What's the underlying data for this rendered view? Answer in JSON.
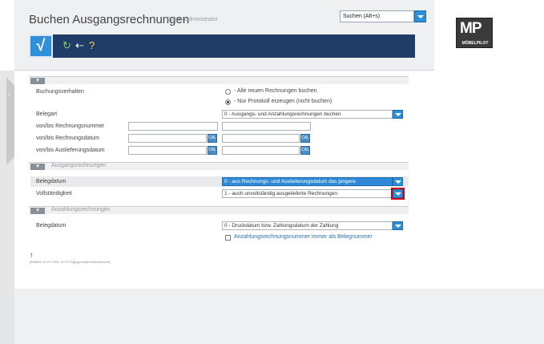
{
  "header": {
    "title": "Buchen Ausgangsrechnungen",
    "subtitle": "Systemadministrator",
    "search_value": "Suchen (Alt+s)"
  },
  "toolbar": {
    "confirm_glyph": "√",
    "refresh_glyph": "↻",
    "back_glyph": "⇠",
    "help_glyph": "?"
  },
  "logo": {
    "mark": "MP",
    "text": "MÖBELPILOT"
  },
  "sections": {
    "main": {
      "toggle": "▾"
    },
    "ausgang": {
      "toggle": "▾",
      "title": "Ausgangsrechnungen"
    },
    "anzahlung": {
      "toggle": "▾",
      "title": "Anzahlungsrechnungen"
    }
  },
  "form": {
    "buchungsverhalten": {
      "label": "Buchungsverhalten",
      "options": [
        "- Alle neuen Rechnungen buchen",
        "- Nur Protokoll erzeugen (nicht buchen)"
      ],
      "selected_index": 1
    },
    "belegart": {
      "label": "Belegart",
      "value": "0 - Ausgangs- und Anzahlungsrechnungen buchen"
    },
    "rechnungsnummer": {
      "label": "von/bis Rechnungsnummer",
      "from": "",
      "to": ""
    },
    "rechnungsdatum": {
      "label": "von/bis Rechnungsdatum",
      "from": "",
      "to": ""
    },
    "auslieferungsdatum": {
      "label": "von/bis Auslieferungsdatum",
      "from": "",
      "to": ""
    },
    "belegdatum": {
      "label": "Belegdatum",
      "value": "0 - aus Rechnungs- und Auslieferungsdatum das jüngere"
    },
    "vollstaendigkeit": {
      "label": "Vollständigkeit",
      "value": "1 - auch unvollständig ausgelieferte Rechnungen"
    },
    "anz_belegdatum": {
      "label": "Belegdatum",
      "value": "0 - Druckdatum bzw. Zahlungsdatum der Zahlung"
    },
    "anz_nummer": {
      "label": "Anzahlungsrechnungsnummer immer als Belegnummer",
      "checked": false
    }
  },
  "calendar_label": "CAL",
  "footer": {
    "up_glyph": "↑",
    "info": "[ADMIN, 04.07.2016, 11:37:22][support@moebelpilot.de]"
  },
  "colors": {
    "accent": "#2d8fd6",
    "toolbar": "#1f3d66",
    "highlight": "#d0021b"
  }
}
